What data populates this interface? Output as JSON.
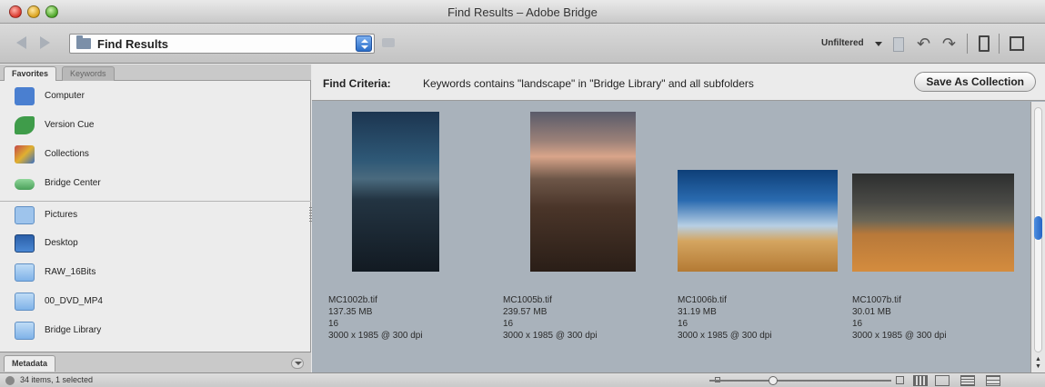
{
  "window": {
    "title": "Find Results – Adobe Bridge"
  },
  "toolbar": {
    "path_label": "Find Results",
    "filter_label": "Unfiltered",
    "icons": [
      "back-arrow-icon",
      "forward-arrow-icon",
      "folder-icon",
      "new-folder-icon",
      "rotate-left-icon",
      "rotate-right-icon",
      "trash-icon",
      "compact-mode-icon"
    ]
  },
  "sidebar": {
    "tabs": [
      "Favorites",
      "Keywords"
    ],
    "items": [
      {
        "label": "Computer",
        "icon": "computer-icon",
        "color": "#4a7fd0"
      },
      {
        "label": "Version Cue",
        "icon": "version-cue-icon",
        "color": "#3f9c4a"
      },
      {
        "label": "Collections",
        "icon": "collections-icon",
        "color": "#c44848"
      },
      {
        "label": "Bridge Center",
        "icon": "bridge-center-icon",
        "color": "#5ab36a"
      },
      {
        "label": "Pictures",
        "icon": "pictures-folder-icon",
        "color": "#7fb2e8"
      },
      {
        "label": "Desktop",
        "icon": "desktop-icon",
        "color": "#3b6fb8"
      },
      {
        "label": "RAW_16Bits",
        "icon": "folder-icon",
        "color": "#7fb2e8"
      },
      {
        "label": "00_DVD_MP4",
        "icon": "folder-icon",
        "color": "#7fb2e8"
      },
      {
        "label": "Bridge Library",
        "icon": "folder-icon",
        "color": "#7fb2e8"
      }
    ],
    "metadata_tab": "Metadata"
  },
  "content": {
    "criteria_label": "Find Criteria:",
    "criteria_text": "Keywords contains \"landscape\" in \"Bridge Library\" and all subfolders",
    "save_button": "Save As Collection",
    "thumbnails": [
      {
        "filename": "MC1002b.tif",
        "size": "137.35 MB",
        "bit_depth": "16",
        "dimensions": "3000 x 1985 @ 300 dpi"
      },
      {
        "filename": "MC1005b.tif",
        "size": "239.57 MB",
        "bit_depth": "16",
        "dimensions": "3000 x 1985 @ 300 dpi"
      },
      {
        "filename": "MC1006b.tif",
        "size": "31.19 MB",
        "bit_depth": "16",
        "dimensions": "3000 x 1985 @ 300 dpi"
      },
      {
        "filename": "MC1007b.tif",
        "size": "30.01 MB",
        "bit_depth": "16",
        "dimensions": "3000 x 1985 @ 300 dpi"
      }
    ]
  },
  "status": {
    "text": "34 items, 1 selected"
  },
  "colors": {
    "content_bg": "#a9b2bb",
    "accent": "#2565c4"
  }
}
